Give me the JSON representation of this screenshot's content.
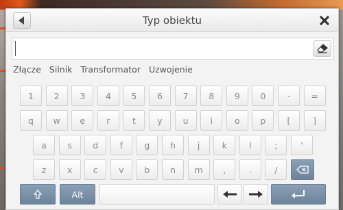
{
  "dialog": {
    "title": "Typ obiektu",
    "back_icon": "back-arrow-icon",
    "close_icon": "close-icon",
    "input": {
      "value": "",
      "placeholder": ""
    },
    "clear_icon": "eraser-icon"
  },
  "suggestions": [
    "Złącze",
    "Silnik",
    "Transformator",
    "Uzwojenie"
  ],
  "keyboard": {
    "row1": [
      "1",
      "2",
      "3",
      "4",
      "5",
      "6",
      "7",
      "8",
      "9",
      "0",
      "-",
      "="
    ],
    "row2": [
      "q",
      "w",
      "e",
      "r",
      "t",
      "y",
      "u",
      "i",
      "o",
      "p",
      "[",
      "]"
    ],
    "row3": [
      "a",
      "s",
      "d",
      "f",
      "g",
      "h",
      "j",
      "k",
      "l",
      ";",
      "'"
    ],
    "row4": [
      "z",
      "x",
      "c",
      "v",
      "b",
      "n",
      "m",
      ",",
      ".",
      "/"
    ],
    "backspace_icon": "backspace-icon",
    "shift_icon": "shift-up-arrow-icon",
    "alt_label": "Alt",
    "left_arrow_icon": "arrow-left-icon",
    "right_arrow_icon": "arrow-right-icon",
    "enter_icon": "enter-icon"
  },
  "colors": {
    "accent_key": "#7a90a6",
    "key_text": "#8a8a8a",
    "dialog_bg": "#f3f3f3"
  }
}
